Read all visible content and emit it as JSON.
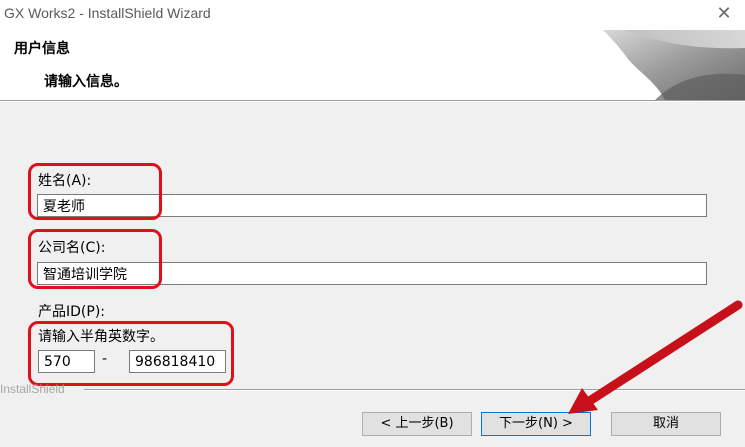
{
  "window": {
    "title": "GX Works2 - InstallShield Wizard",
    "close_icon": "close-icon"
  },
  "header": {
    "title": "用户信息",
    "subtitle": "请输入信息。"
  },
  "form": {
    "name_label": "姓名(A):",
    "name_value": "夏老师",
    "company_label": "公司名(C):",
    "company_value": "智通培训学院",
    "product_id_label": "产品ID(P):",
    "product_id_hint": "请输入半角英数字。",
    "product_id_part1": "570",
    "product_id_separator": "-",
    "product_id_part2": "986818410"
  },
  "footer": {
    "brand": "InstallShield",
    "back_label": "< 上一步(B)",
    "next_label": "下一步(N) >",
    "cancel_label": "取消"
  },
  "colors": {
    "annotation_red": "#e0101a",
    "arrow_red": "#c8101a",
    "background": "#f0f0f0"
  }
}
